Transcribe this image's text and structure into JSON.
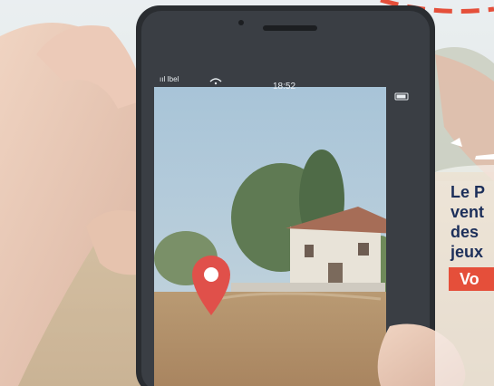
{
  "status_bar": {
    "carrier": "ııl Ibel",
    "time": "18:52"
  },
  "promo": {
    "lines": [
      "Le P",
      "vent",
      "des",
      "jeux"
    ],
    "cta_label": "Vo"
  },
  "colors": {
    "accent": "#e54f3a",
    "headline": "#1c2f5a",
    "map_pin": "#e0504a"
  },
  "icons": [
    "map-pin-icon",
    "wifi-icon",
    "battery-icon"
  ]
}
